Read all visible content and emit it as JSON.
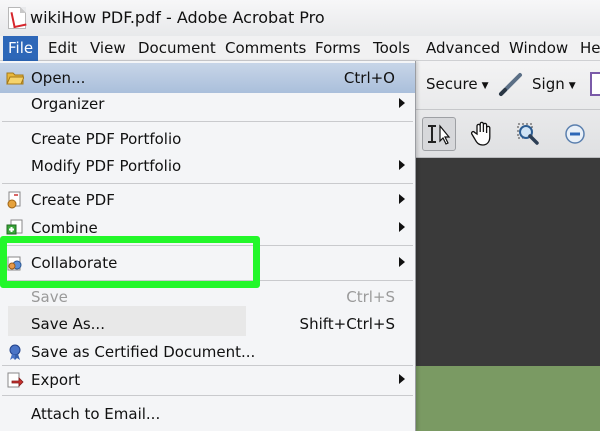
{
  "window": {
    "title": "wikiHow PDF.pdf - Adobe Acrobat Pro"
  },
  "menubar": {
    "items": [
      "File",
      "Edit",
      "View",
      "Document",
      "Comments",
      "Forms",
      "Tools",
      "Advanced",
      "Window",
      "He"
    ]
  },
  "toolbar": {
    "secure_label": "Secure",
    "sign_label": "Sign"
  },
  "file_menu": {
    "open": {
      "label": "Open...",
      "shortcut": "Ctrl+O"
    },
    "organizer": {
      "label": "Organizer"
    },
    "create_portfolio": {
      "label": "Create PDF Portfolio"
    },
    "modify_portfolio": {
      "label": "Modify PDF Portfolio"
    },
    "create_pdf": {
      "label": "Create PDF"
    },
    "combine": {
      "label": "Combine"
    },
    "collaborate": {
      "label": "Collaborate"
    },
    "save": {
      "label": "Save",
      "shortcut": "Ctrl+S"
    },
    "save_as": {
      "label": "Save As...",
      "shortcut": "Shift+Ctrl+S"
    },
    "save_certified": {
      "label": "Save as Certified Document..."
    },
    "export": {
      "label": "Export"
    },
    "attach_email": {
      "label": "Attach to Email..."
    }
  },
  "colors": {
    "highlight_frame": "#23f72a",
    "menu_active": "#2d67b8"
  }
}
